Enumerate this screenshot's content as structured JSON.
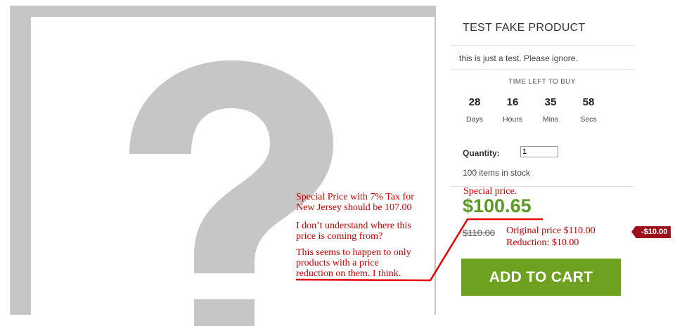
{
  "product": {
    "title": "TEST FAKE PRODUCT",
    "description": "this is just a test. Please ignore.",
    "image_icon": "question-mark-placeholder",
    "timer": {
      "label": "TIME LEFT TO BUY",
      "units": [
        {
          "value": "28",
          "unit": "Days"
        },
        {
          "value": "16",
          "unit": "Hours"
        },
        {
          "value": "35",
          "unit": "Mins"
        },
        {
          "value": "58",
          "unit": "Secs"
        }
      ]
    },
    "quantity_label": "Quantity:",
    "quantity_value": "1",
    "stock": "100 items in stock",
    "old_price": "$110.00",
    "special_price": "$100.65",
    "discount_badge": "-$10.00",
    "add_to_cart": "ADD TO CART"
  },
  "annotations": {
    "special_label": "Special price.",
    "original_note": [
      "Original price $110.00",
      "Reduction: $10.00"
    ],
    "note1": [
      "Special Price with 7% Tax for",
      "New Jersey should be 107.00"
    ],
    "note2": [
      "I don’t understand where this",
      "price is coming from?"
    ],
    "note3": [
      "This seems to happen to only",
      "products with a price",
      "reduction on them. I think."
    ],
    "color": "#cc0000"
  },
  "colors": {
    "price_green": "#5d9b25",
    "cart_button": "#6da11f",
    "badge": "#9e0f1c"
  }
}
